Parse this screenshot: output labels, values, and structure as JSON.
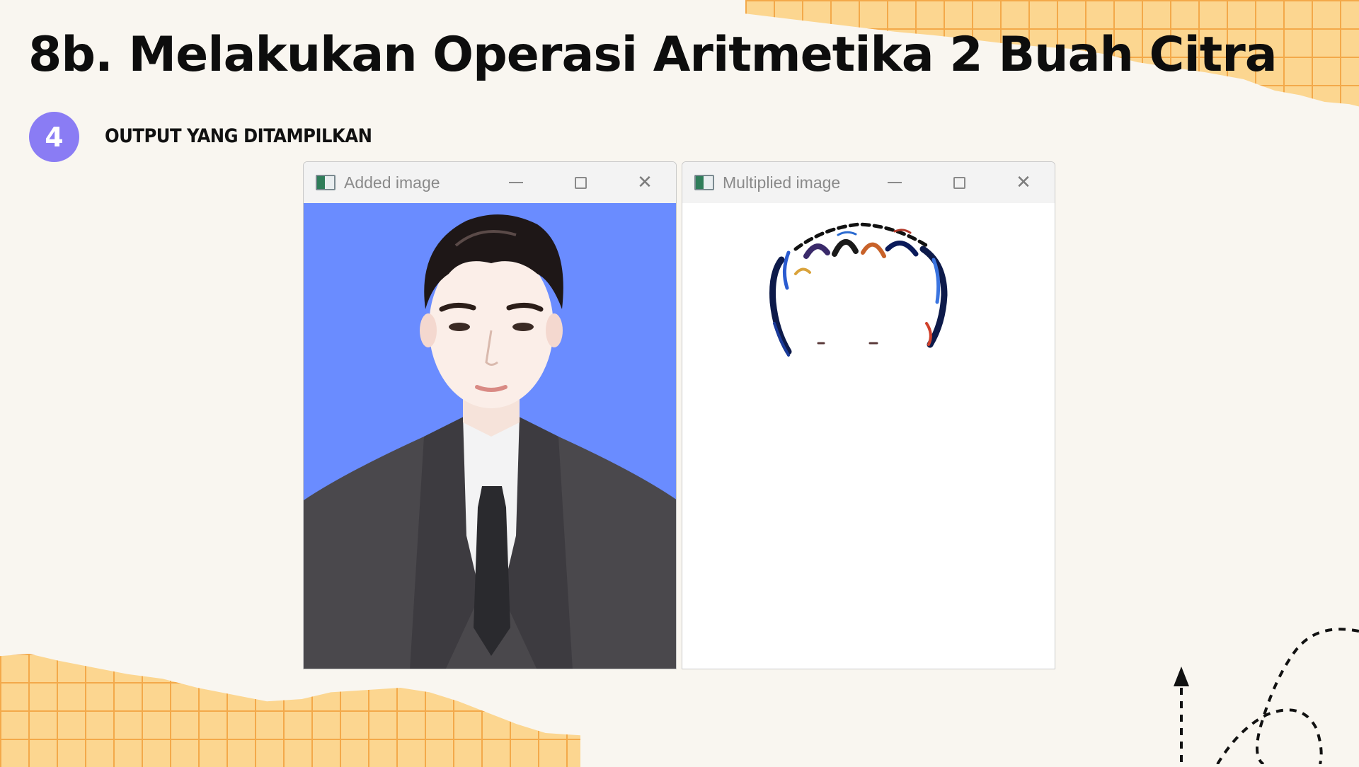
{
  "slide": {
    "title": "8b. Melakukan Operasi Aritmetika 2 Buah Citra",
    "step_number": "4",
    "step_label": "OUTPUT YANG DITAMPILKAN"
  },
  "windows": [
    {
      "title": "Added image",
      "icon": "image-app-icon",
      "controls": [
        "minimize-icon",
        "maximize-icon",
        "close-icon"
      ]
    },
    {
      "title": "Multiplied image",
      "icon": "image-app-icon",
      "controls": [
        "minimize-icon",
        "maximize-icon",
        "close-icon"
      ]
    }
  ],
  "glyphs": {
    "close": "✕"
  },
  "colors": {
    "background": "#f9f6f0",
    "grid_paper": "#fcd690",
    "grid_lines": "#f3a94a",
    "step_circle": "#8a7cf4",
    "added_image_background": "#6a8cff"
  }
}
